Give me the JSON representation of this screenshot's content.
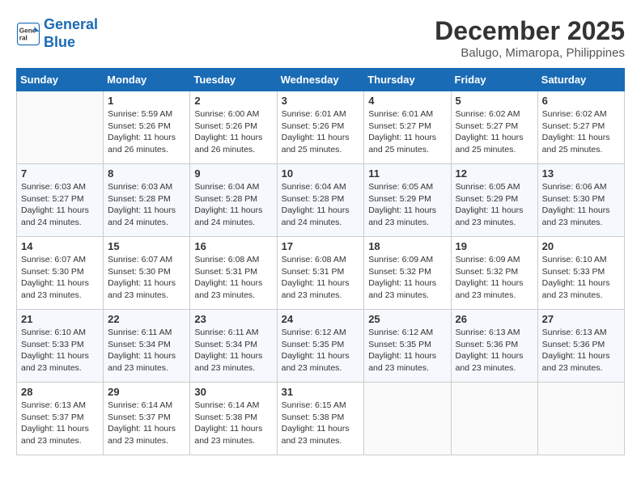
{
  "header": {
    "logo_line1": "General",
    "logo_line2": "Blue",
    "month_title": "December 2025",
    "location": "Balugo, Mimaropa, Philippines"
  },
  "weekdays": [
    "Sunday",
    "Monday",
    "Tuesday",
    "Wednesday",
    "Thursday",
    "Friday",
    "Saturday"
  ],
  "weeks": [
    [
      {
        "day": "",
        "info": ""
      },
      {
        "day": "1",
        "info": "Sunrise: 5:59 AM\nSunset: 5:26 PM\nDaylight: 11 hours\nand 26 minutes."
      },
      {
        "day": "2",
        "info": "Sunrise: 6:00 AM\nSunset: 5:26 PM\nDaylight: 11 hours\nand 26 minutes."
      },
      {
        "day": "3",
        "info": "Sunrise: 6:01 AM\nSunset: 5:26 PM\nDaylight: 11 hours\nand 25 minutes."
      },
      {
        "day": "4",
        "info": "Sunrise: 6:01 AM\nSunset: 5:27 PM\nDaylight: 11 hours\nand 25 minutes."
      },
      {
        "day": "5",
        "info": "Sunrise: 6:02 AM\nSunset: 5:27 PM\nDaylight: 11 hours\nand 25 minutes."
      },
      {
        "day": "6",
        "info": "Sunrise: 6:02 AM\nSunset: 5:27 PM\nDaylight: 11 hours\nand 25 minutes."
      }
    ],
    [
      {
        "day": "7",
        "info": "Sunrise: 6:03 AM\nSunset: 5:27 PM\nDaylight: 11 hours\nand 24 minutes."
      },
      {
        "day": "8",
        "info": "Sunrise: 6:03 AM\nSunset: 5:28 PM\nDaylight: 11 hours\nand 24 minutes."
      },
      {
        "day": "9",
        "info": "Sunrise: 6:04 AM\nSunset: 5:28 PM\nDaylight: 11 hours\nand 24 minutes."
      },
      {
        "day": "10",
        "info": "Sunrise: 6:04 AM\nSunset: 5:28 PM\nDaylight: 11 hours\nand 24 minutes."
      },
      {
        "day": "11",
        "info": "Sunrise: 6:05 AM\nSunset: 5:29 PM\nDaylight: 11 hours\nand 23 minutes."
      },
      {
        "day": "12",
        "info": "Sunrise: 6:05 AM\nSunset: 5:29 PM\nDaylight: 11 hours\nand 23 minutes."
      },
      {
        "day": "13",
        "info": "Sunrise: 6:06 AM\nSunset: 5:30 PM\nDaylight: 11 hours\nand 23 minutes."
      }
    ],
    [
      {
        "day": "14",
        "info": "Sunrise: 6:07 AM\nSunset: 5:30 PM\nDaylight: 11 hours\nand 23 minutes."
      },
      {
        "day": "15",
        "info": "Sunrise: 6:07 AM\nSunset: 5:30 PM\nDaylight: 11 hours\nand 23 minutes."
      },
      {
        "day": "16",
        "info": "Sunrise: 6:08 AM\nSunset: 5:31 PM\nDaylight: 11 hours\nand 23 minutes."
      },
      {
        "day": "17",
        "info": "Sunrise: 6:08 AM\nSunset: 5:31 PM\nDaylight: 11 hours\nand 23 minutes."
      },
      {
        "day": "18",
        "info": "Sunrise: 6:09 AM\nSunset: 5:32 PM\nDaylight: 11 hours\nand 23 minutes."
      },
      {
        "day": "19",
        "info": "Sunrise: 6:09 AM\nSunset: 5:32 PM\nDaylight: 11 hours\nand 23 minutes."
      },
      {
        "day": "20",
        "info": "Sunrise: 6:10 AM\nSunset: 5:33 PM\nDaylight: 11 hours\nand 23 minutes."
      }
    ],
    [
      {
        "day": "21",
        "info": "Sunrise: 6:10 AM\nSunset: 5:33 PM\nDaylight: 11 hours\nand 23 minutes."
      },
      {
        "day": "22",
        "info": "Sunrise: 6:11 AM\nSunset: 5:34 PM\nDaylight: 11 hours\nand 23 minutes."
      },
      {
        "day": "23",
        "info": "Sunrise: 6:11 AM\nSunset: 5:34 PM\nDaylight: 11 hours\nand 23 minutes."
      },
      {
        "day": "24",
        "info": "Sunrise: 6:12 AM\nSunset: 5:35 PM\nDaylight: 11 hours\nand 23 minutes."
      },
      {
        "day": "25",
        "info": "Sunrise: 6:12 AM\nSunset: 5:35 PM\nDaylight: 11 hours\nand 23 minutes."
      },
      {
        "day": "26",
        "info": "Sunrise: 6:13 AM\nSunset: 5:36 PM\nDaylight: 11 hours\nand 23 minutes."
      },
      {
        "day": "27",
        "info": "Sunrise: 6:13 AM\nSunset: 5:36 PM\nDaylight: 11 hours\nand 23 minutes."
      }
    ],
    [
      {
        "day": "28",
        "info": "Sunrise: 6:13 AM\nSunset: 5:37 PM\nDaylight: 11 hours\nand 23 minutes."
      },
      {
        "day": "29",
        "info": "Sunrise: 6:14 AM\nSunset: 5:37 PM\nDaylight: 11 hours\nand 23 minutes."
      },
      {
        "day": "30",
        "info": "Sunrise: 6:14 AM\nSunset: 5:38 PM\nDaylight: 11 hours\nand 23 minutes."
      },
      {
        "day": "31",
        "info": "Sunrise: 6:15 AM\nSunset: 5:38 PM\nDaylight: 11 hours\nand 23 minutes."
      },
      {
        "day": "",
        "info": ""
      },
      {
        "day": "",
        "info": ""
      },
      {
        "day": "",
        "info": ""
      }
    ]
  ]
}
